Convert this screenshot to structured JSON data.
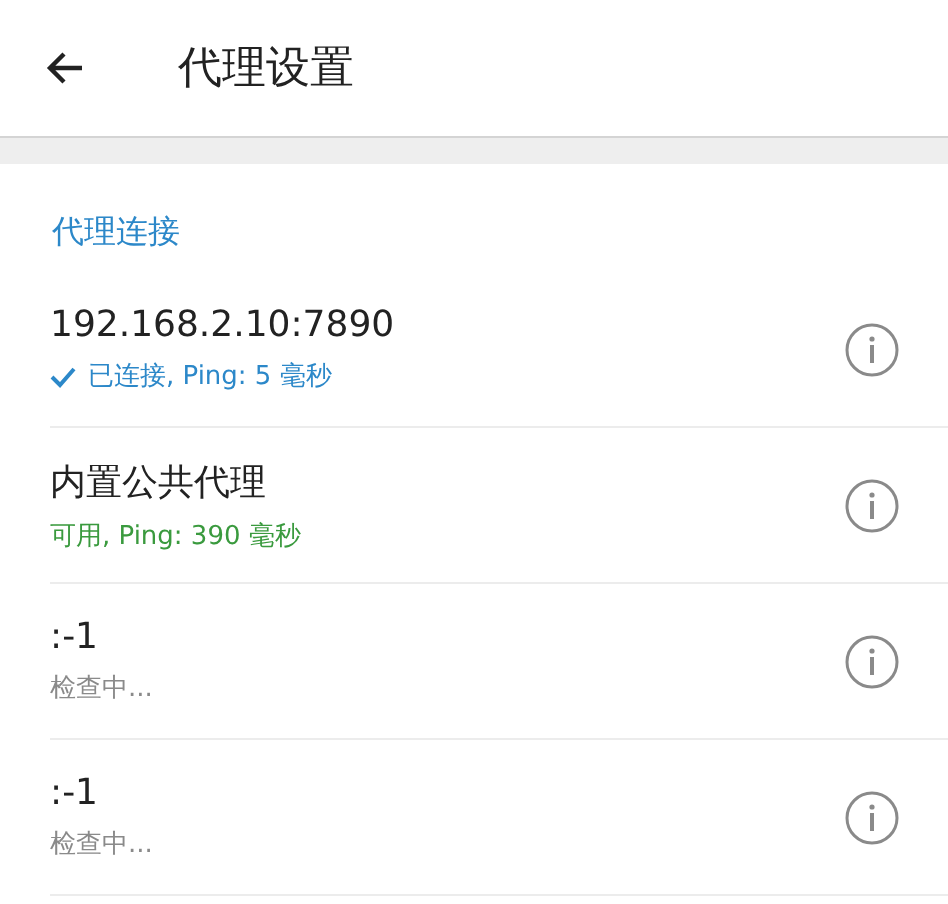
{
  "app_bar": {
    "title": "代理设置"
  },
  "section": {
    "title": "代理连接"
  },
  "proxies": [
    {
      "name": "192.168.2.10:7890",
      "status": "已连接, Ping: 5 毫秒",
      "kind": "connected"
    },
    {
      "name": "内置公共代理",
      "status": "可用, Ping: 390 毫秒",
      "kind": "available"
    },
    {
      "name": ":-1",
      "status": "检查中...",
      "kind": "checking"
    },
    {
      "name": ":-1",
      "status": "检查中...",
      "kind": "checking"
    }
  ]
}
